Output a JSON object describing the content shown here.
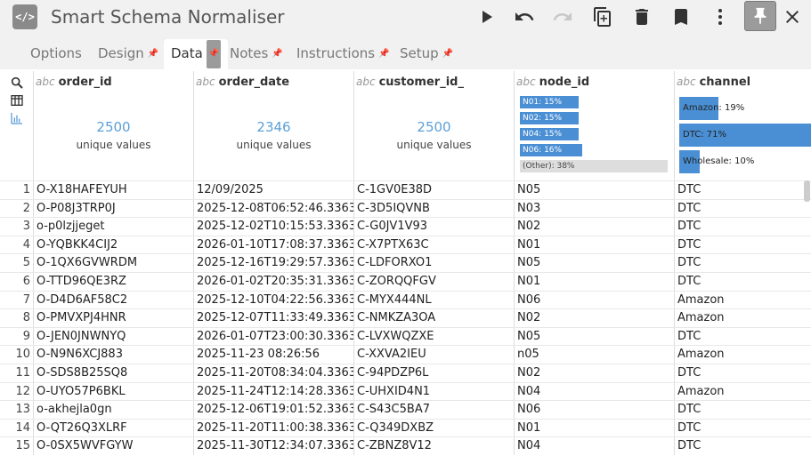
{
  "app": {
    "title": "Smart Schema Normaliser",
    "icon_glyph": "</>"
  },
  "toolbar": {
    "buttons": [
      "play-icon",
      "undo-icon",
      "redo-icon",
      "copy-icon",
      "delete-icon",
      "bookmark-icon",
      "more-icon",
      "pin-icon",
      "close-icon"
    ]
  },
  "tabs": [
    {
      "label": "Options",
      "pinned": false,
      "active": false
    },
    {
      "label": "Design",
      "pinned": true,
      "active": false
    },
    {
      "label": "Data",
      "pinned": true,
      "active": true
    },
    {
      "label": "Notes",
      "pinned": true,
      "active": false
    },
    {
      "label": "Instructions",
      "pinned": true,
      "active": false
    },
    {
      "label": "Setup",
      "pinned": true,
      "active": false
    }
  ],
  "columns": [
    {
      "type": "abc",
      "name": "order_id",
      "unique_count": "2500",
      "unique_label": "unique values"
    },
    {
      "type": "abc",
      "name": "order_date",
      "unique_count": "2346",
      "unique_label": "unique values"
    },
    {
      "type": "abc",
      "name": "customer_id_",
      "unique_count": "2500",
      "unique_label": "unique values"
    },
    {
      "type": "abc",
      "name": "node_id",
      "bars": [
        "N01: 15%",
        "N02: 15%",
        "N04: 15%",
        "N06: 16%",
        "(Other): 38%"
      ],
      "bar_values": [
        15,
        15,
        15,
        16,
        38
      ]
    },
    {
      "type": "abc",
      "name": "channel",
      "bars": [
        "Amazon: 19%",
        "DTC: 71%",
        "Wholesale: 10%"
      ],
      "bar_values": [
        19,
        71,
        10
      ]
    }
  ],
  "colors": {
    "accent": "#4a8fd4",
    "link": "#5a9fd8",
    "other_bar": "#dddddd"
  },
  "rows": [
    [
      "1",
      "O-X18HAFEYUH",
      "12/09/2025",
      "C-1GV0E38D",
      "N05",
      "DTC"
    ],
    [
      "2",
      "O-P08J3TRP0J",
      "2025-12-08T06:52:46.3363...",
      "C-3D5IQVNB",
      "N03",
      "DTC"
    ],
    [
      "3",
      "o-p0lzjjeget",
      "2025-12-02T10:15:53.3363...",
      "C-G0JV1V93",
      "N02",
      "DTC"
    ],
    [
      "4",
      "O-YQBKK4CIJ2",
      "2026-01-10T17:08:37.3363...",
      "C-X7PTX63C",
      "N01",
      "DTC"
    ],
    [
      "5",
      "O-1QX6GVWRDM",
      "2025-12-16T19:29:57.3363...",
      "C-LDFORXO1",
      "N05",
      "DTC"
    ],
    [
      "6",
      "O-TTD96QE3RZ",
      "2026-01-02T20:35:31.3363...",
      "C-ZORQQFGV",
      "N01",
      "DTC"
    ],
    [
      "7",
      "O-D4D6AF58C2",
      "2025-12-10T04:22:56.3363...",
      "C-MYX444NL",
      "N06",
      "Amazon"
    ],
    [
      "8",
      "O-PMVXPJ4HNR",
      "2025-12-07T11:33:49.3363...",
      "C-NMKZA3OA",
      "N02",
      "Amazon"
    ],
    [
      "9",
      "O-JEN0JNWNYQ",
      "2026-01-07T23:00:30.3363...",
      "C-LVXWQZXE",
      "N05",
      "DTC"
    ],
    [
      "10",
      "O-N9N6XCJ883",
      "2025-11-23 08:26:56",
      "C-XXVA2IEU",
      "n05",
      "Amazon"
    ],
    [
      "11",
      "O-SDS8B25SQ8",
      "2025-11-20T08:34:04.3363...",
      "C-94PDZP6L",
      "N02",
      "DTC"
    ],
    [
      "12",
      "O-UYO57P6BKL",
      "2025-11-24T12:14:28.3363...",
      "C-UHXID4N1",
      "N04",
      "Amazon"
    ],
    [
      "13",
      "o-akhejla0gn",
      "2025-12-06T19:01:52.3363...",
      "C-S43C5BA7",
      "N06",
      "DTC"
    ],
    [
      "14",
      "O-QT26Q3XLRF",
      "2025-11-20T11:00:38.3363...",
      "C-Q349DXBZ",
      "N01",
      "DTC"
    ],
    [
      "15",
      "O-0SX5WVFGYW",
      "2025-11-30T12:34:07.3363...",
      "C-ZBNZ8V12",
      "N04",
      "DTC"
    ]
  ]
}
